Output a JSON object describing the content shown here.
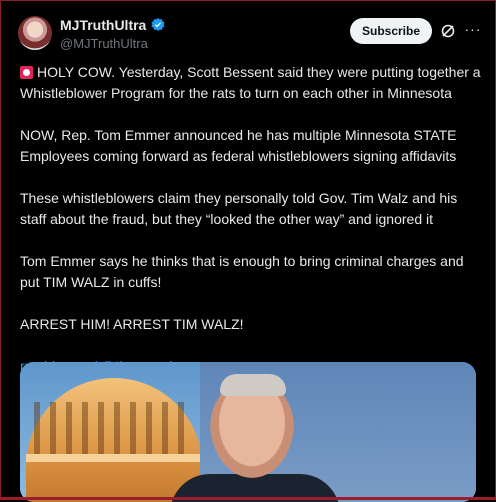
{
  "author": {
    "display_name": "MJTruthUltra",
    "handle": "@MJTruthUltra"
  },
  "actions": {
    "subscribe_label": "Subscribe",
    "more_label": "···"
  },
  "post": {
    "paragraphs": [
      "HOLY COW. Yesterday, Scott Bessent said they were putting together a Whistleblower Program for the rats to turn on each other in Minnesota",
      "NOW, Rep. Tom Emmer announced he has multiple Minnesota STATE Employees coming forward as federal whistleblowers signing affidavits",
      "These whistleblowers claim they personally told Gov. Tim Walz and his staff about the fraud, but they “looked the other way” and ignored it",
      "Tom Emmer says he thinks that is enough to bring criminal charges and put TIM WALZ in cuffs!",
      "ARREST HIM! ARREST TIM WALZ!"
    ],
    "link": "rumble.com/v74bqgw-minnes..."
  },
  "colors": {
    "accent_link": "#1d9bf0",
    "verified": "#1d9bf0",
    "background": "#000000"
  },
  "icons": {
    "verified": "verified-badge-icon",
    "grok": "grok-icon",
    "siren": "siren-emoji-icon"
  }
}
